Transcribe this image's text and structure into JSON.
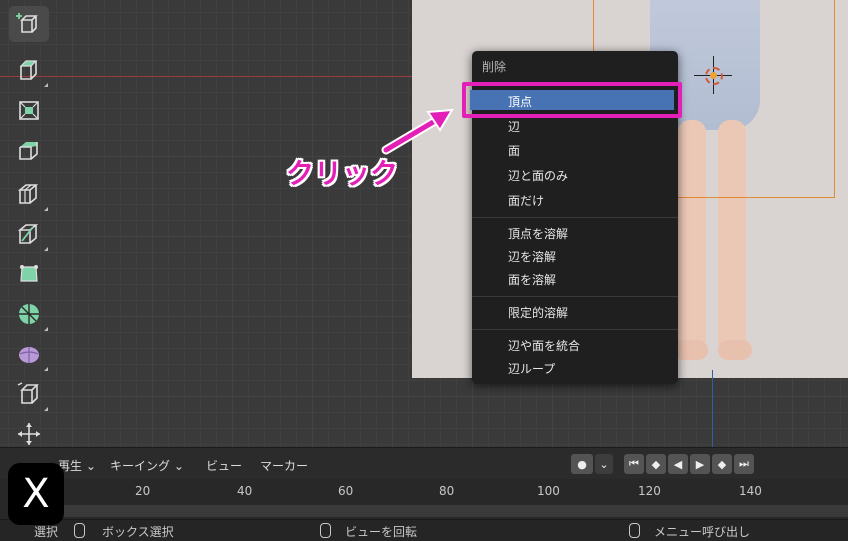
{
  "context_menu": {
    "title": "削除",
    "items": [
      "頂点",
      "辺",
      "面",
      "辺と面のみ",
      "面だけ",
      "頂点を溶解",
      "辺を溶解",
      "面を溶解",
      "限定的溶解",
      "辺や面を統合",
      "辺ループ"
    ],
    "selected": "頂点"
  },
  "annotation": {
    "text": "クリック",
    "color": "#e41fb7"
  },
  "timeline": {
    "playback": "再生",
    "keying": "キーイング",
    "view": "ビュー",
    "marker": "マーカー",
    "frames": [
      "20",
      "40",
      "60",
      "80",
      "100",
      "120",
      "140"
    ]
  },
  "statusbar": {
    "select": "選択",
    "box_select": "ボックス選択",
    "rotate_view": "ビューを回転",
    "call_menu": "メニュー呼び出し"
  },
  "badge": {
    "text": "X"
  },
  "colors": {
    "highlight_border": "#e41fb7",
    "selected_item": "#4772b3",
    "tool_green": "#7fd3a8",
    "tool_purple": "#b89ad8"
  }
}
